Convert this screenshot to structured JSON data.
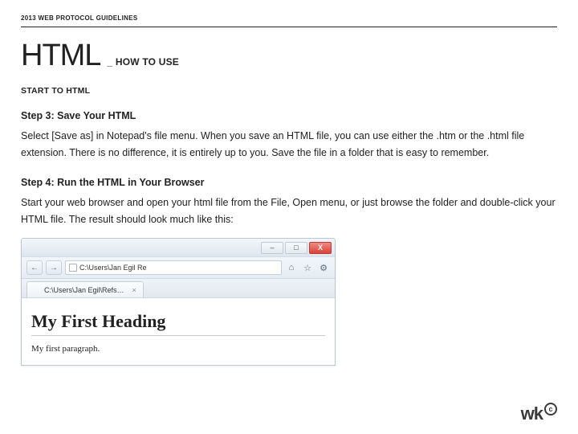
{
  "header": {
    "topline": "2013 WEB PROTOCOL GUIDELINES",
    "title_big": "HTML",
    "title_sub": "_ HOW TO USE",
    "section": "START TO HTML"
  },
  "steps": [
    {
      "heading": "Step 3: Save Your HTML",
      "body": "Select [Save as] in Notepad's file menu. When you save an HTML file, you can use either the .htm or the .html file extension. There is no difference, it is entirely up to you. Save the file in a folder that is easy to remember."
    },
    {
      "heading": "Step 4: Run the HTML in Your Browser",
      "body": "Start your web browser and open your html file from the File, Open menu, or just browse the folder and double-click your HTML file. The result should look much like this:"
    }
  ],
  "browser": {
    "window_buttons": {
      "min": "–",
      "max": "□",
      "close": "X"
    },
    "nav": {
      "back": "←",
      "forward": "→"
    },
    "address": "C:\\Users\\Jan Egil Re",
    "tab_label": "C:\\Users\\Jan Egil\\Refs…",
    "tab_close": "×",
    "toolbar_icons": {
      "home": "⌂",
      "star": "☆",
      "gear": "⚙"
    },
    "content": {
      "heading": "My First Heading",
      "paragraph": "My first paragraph."
    }
  },
  "footer": {
    "logo_text": "wk",
    "copyright_glyph": "c"
  }
}
